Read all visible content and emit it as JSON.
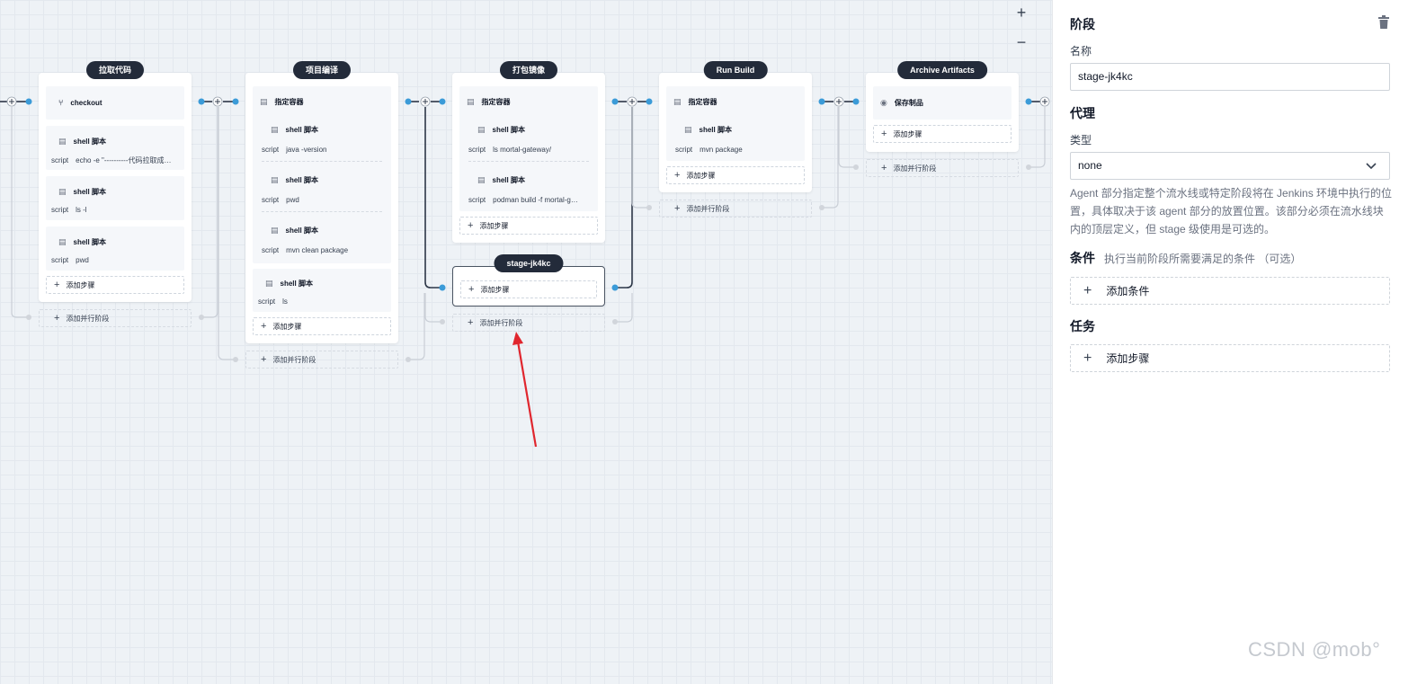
{
  "stages": [
    {
      "title": "拉取代码",
      "steps": [
        {
          "icon": "terminal-icon",
          "name": "checkout"
        },
        {
          "icon": "terminal-icon",
          "name": "shell 脚本",
          "script_key": "script",
          "script_value": "echo -e \"----------代码拉取成功----------\""
        },
        {
          "icon": "terminal-icon",
          "name": "shell 脚本",
          "script_key": "script",
          "script_value": "ls -l"
        },
        {
          "icon": "terminal-icon",
          "name": "shell 脚本",
          "script_key": "script",
          "script_value": "pwd"
        }
      ],
      "add_step_label": "添加步骤",
      "add_parallel_label": "添加并行阶段"
    },
    {
      "title": "项目编译",
      "container_label": "指定容器",
      "steps": [
        {
          "name": "shell 脚本",
          "script_key": "script",
          "script_value": "java -version"
        },
        {
          "name": "shell 脚本",
          "script_key": "script",
          "script_value": "pwd"
        },
        {
          "name": "shell 脚本",
          "script_key": "script",
          "script_value": "mvn clean package"
        }
      ],
      "outer_step": {
        "name": "shell 脚本",
        "script_key": "script",
        "script_value": "ls"
      },
      "add_step_label": "添加步骤",
      "add_parallel_label": "添加并行阶段"
    },
    {
      "title": "打包镜像",
      "container_label": "指定容器",
      "steps": [
        {
          "name": "shell 脚本",
          "script_key": "script",
          "script_value": "ls mortal-gateway/"
        },
        {
          "name": "shell 脚本",
          "script_key": "script",
          "script_value": "podman build -f mortal-gateway/Dockerfile"
        }
      ],
      "add_step_label": "添加步骤",
      "parallel_stage": {
        "title": "stage-jk4kc",
        "add_step_label": "添加步骤"
      },
      "add_parallel_label": "添加并行阶段"
    },
    {
      "title": "Run Build",
      "container_label": "指定容器",
      "steps": [
        {
          "name": "shell 脚本",
          "script_key": "script",
          "script_value": "mvn package"
        }
      ],
      "add_step_label": "添加步骤",
      "add_parallel_label": "添加并行阶段"
    },
    {
      "title": "Archive Artifacts",
      "steps": [
        {
          "name": "保存制品"
        }
      ],
      "add_step_label": "添加步骤",
      "add_parallel_label": "添加并行阶段"
    }
  ],
  "zoom": {
    "in": "+",
    "out": "−"
  },
  "panel": {
    "heading": "阶段",
    "name_label": "名称",
    "name_value": "stage-jk4kc",
    "agent_heading": "代理",
    "type_label": "类型",
    "type_value": "none",
    "agent_description": "Agent 部分指定整个流水线或特定阶段将在 Jenkins 环境中执行的位置，具体取决于该 agent 部分的放置位置。该部分必须在流水线块内的顶层定义，但 stage 级使用是可选的。",
    "conditions_heading": "条件",
    "conditions_hint": "执行当前阶段所需要满足的条件 （可选）",
    "add_condition_label": "添加条件",
    "tasks_heading": "任务",
    "add_step_label": "添加步骤"
  },
  "watermark": "CSDN @mob°",
  "colors": {
    "node": "#3b9bd8",
    "pill": "#232b3a",
    "arrow": "#e0262e",
    "wire": "#2d3748",
    "wire_light": "#c9ced6"
  }
}
